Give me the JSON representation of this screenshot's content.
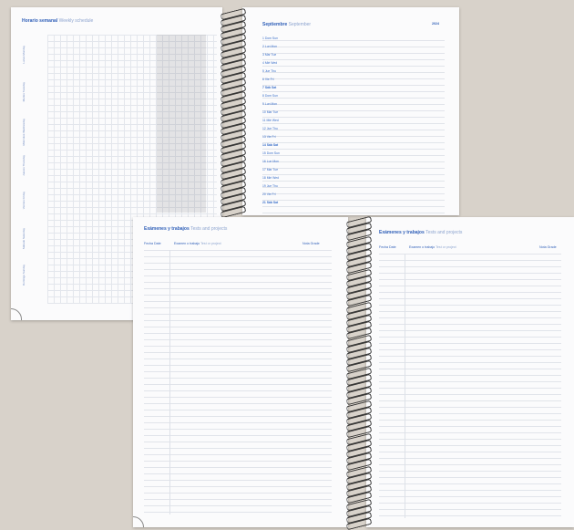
{
  "top_notebook": {
    "left_page": {
      "title_bold": "Horario semanal",
      "title_light": "Weekly schedule",
      "side_labels": [
        "Lunes Monday",
        "Martes Tuesday",
        "Miércoles Wednesday",
        "Jueves Thursday",
        "Viernes Friday",
        "Sábado Saturday",
        "Domingo Sunday"
      ]
    },
    "right_page": {
      "title_bold": "Septiembre",
      "title_light": "September",
      "year": "2024",
      "days": [
        "1 Dom Sun",
        "2 Lun Mon",
        "3 Mar Tue",
        "4 Mié Wed",
        "5 Jue Thu",
        "6 Vie Fri",
        "7 Sáb Sat",
        "8 Dom Sun",
        "9 Lun Mon",
        "10 Mar Tue",
        "11 Mié Wed",
        "12 Jue Thu",
        "13 Vie Fri",
        "14 Sáb Sat",
        "15 Dom Sun",
        "16 Lun Mon",
        "17 Mar Tue",
        "18 Mié Wed",
        "19 Jue Thu",
        "20 Vie Fri",
        "21 Sáb Sat"
      ]
    }
  },
  "bottom_notebook": {
    "left_page": {
      "title_bold": "Exámenes y trabajos",
      "title_light": "Tests and projects",
      "field_fecha": "Fecha Date",
      "field_examen": "Examen o trabajo",
      "field_examen_light": "Test or project",
      "field_nota": "Nota Grade"
    },
    "right_page": {
      "title_bold": "Exámenes y trabajos",
      "title_light": "Tests and projects",
      "field_fecha": "Fecha Date",
      "field_examen": "Examen o trabajo",
      "field_examen_light": "Test or project",
      "field_nota": "Nota Grade"
    }
  }
}
